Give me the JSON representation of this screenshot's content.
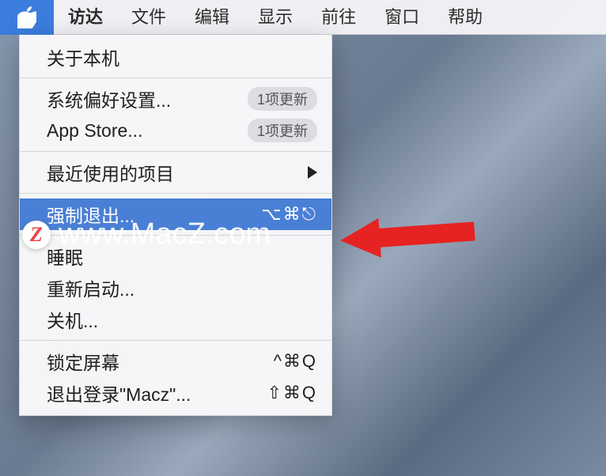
{
  "menubar": {
    "items": [
      {
        "label": "访达",
        "bold": true
      },
      {
        "label": "文件"
      },
      {
        "label": "编辑"
      },
      {
        "label": "显示"
      },
      {
        "label": "前往"
      },
      {
        "label": "窗口"
      },
      {
        "label": "帮助"
      }
    ]
  },
  "apple_menu": {
    "about": "关于本机",
    "sysprefs": {
      "label": "系统偏好设置...",
      "badge": "1项更新"
    },
    "appstore": {
      "label": "App Store...",
      "badge": "1项更新"
    },
    "recent": "最近使用的项目",
    "forcequit": {
      "label": "强制退出...",
      "shortcut": "⌥⌘⎋"
    },
    "sleep": "睡眠",
    "restart": "重新启动...",
    "shutdown": "关机...",
    "lock": {
      "label": "锁定屏幕",
      "shortcut": "^⌘Q"
    },
    "logout": {
      "label": "退出登录\"Macz\"...",
      "shortcut": "⇧⌘Q"
    }
  },
  "watermark": {
    "logo": "Z",
    "text": "www.MacZ.com"
  }
}
